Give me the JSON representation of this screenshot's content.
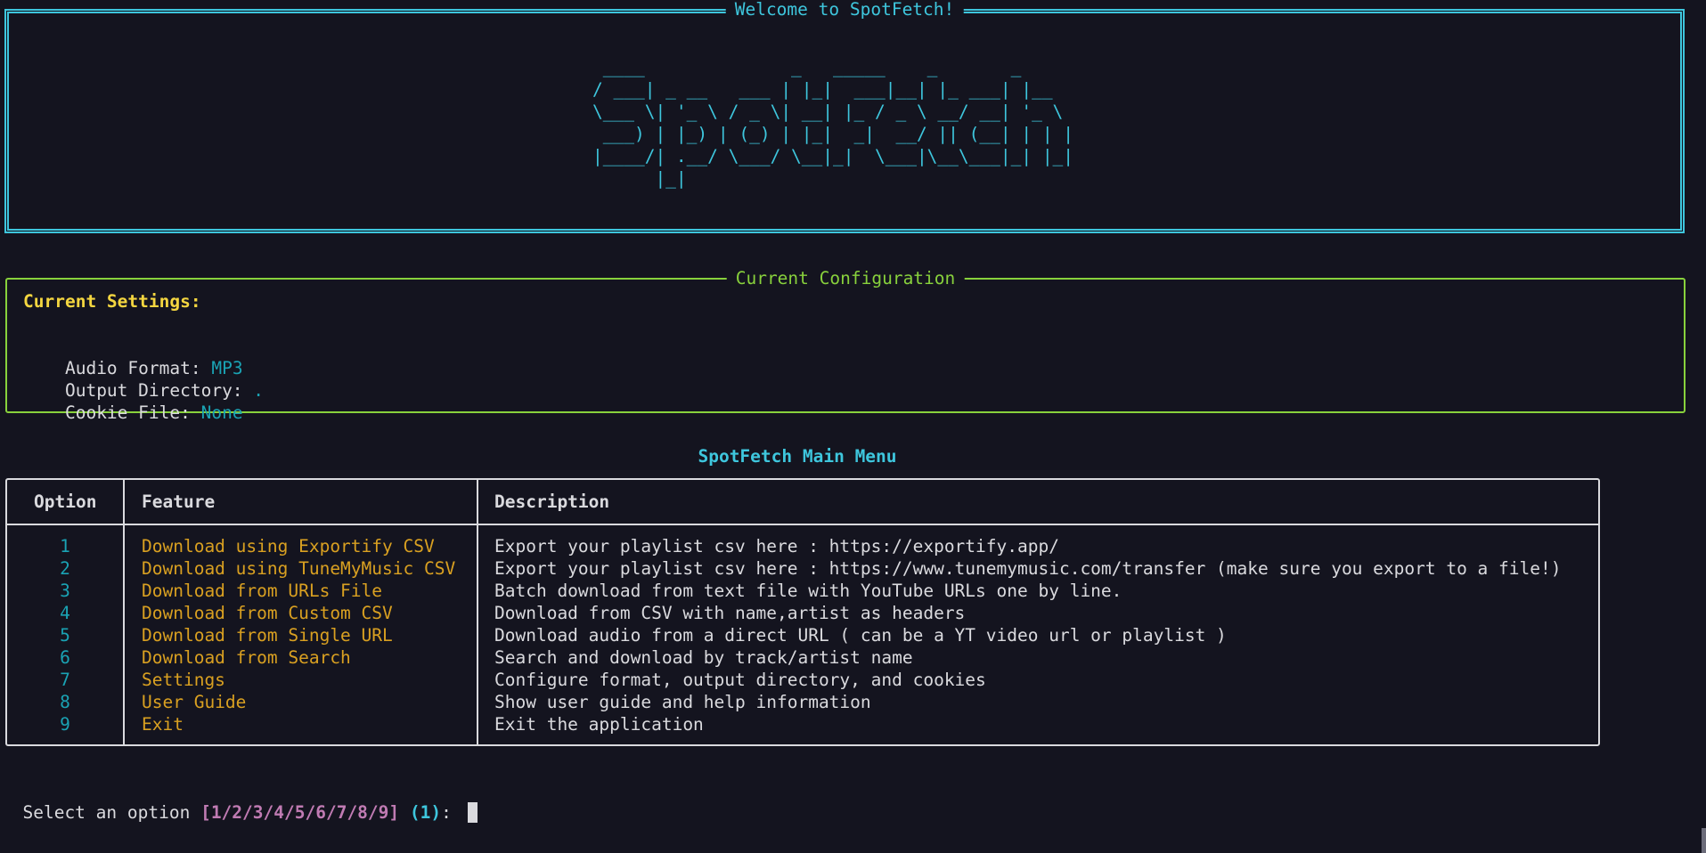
{
  "welcome": {
    "title": "Welcome to SpotFetch!",
    "banner": " ____              _   _____    _       _     \n/ ___| _ __   ___ | |_|  ___|__| |_ ___| |__  \n\\___ \\| '_ \\ / _ \\| __| |_ / _ \\ __/ __| '_ \\ \n ___) | |_) | (_) | |_|  _|  __/ || (__| | | |\n|____/| .__/ \\___/ \\__|_|  \\___|\\__\\___|_| |_|\n      |_|                                     "
  },
  "config": {
    "title": "Current Configuration",
    "heading": "Current Settings:",
    "rows": [
      {
        "label": "Audio Format: ",
        "value": "MP3"
      },
      {
        "label": "Output Directory: ",
        "value": "."
      },
      {
        "label": "Cookie File: ",
        "value": "None"
      }
    ]
  },
  "menu": {
    "title": "SpotFetch Main Menu",
    "headers": [
      "Option",
      "Feature",
      "Description"
    ],
    "rows": [
      {
        "option": "1",
        "feature": "Download using Exportify CSV",
        "description": "Export your playlist csv here : https://exportify.app/"
      },
      {
        "option": "2",
        "feature": "Download using TuneMyMusic CSV",
        "description": "Export your playlist csv here : https://www.tunemymusic.com/transfer (make sure you export to a file!)"
      },
      {
        "option": "3",
        "feature": "Download from URLs File",
        "description": "Batch download from text file with YouTube URLs one by line."
      },
      {
        "option": "4",
        "feature": "Download from Custom CSV",
        "description": "Download from CSV with name,artist as headers"
      },
      {
        "option": "5",
        "feature": "Download from Single URL",
        "description": "Download audio from a direct URL ( can be a YT video url or playlist )"
      },
      {
        "option": "6",
        "feature": "Download from Search",
        "description": "Search and download by track/artist name"
      },
      {
        "option": "7",
        "feature": "Settings",
        "description": "Configure format, output directory, and cookies"
      },
      {
        "option": "8",
        "feature": "User Guide",
        "description": "Show user guide and help information"
      },
      {
        "option": "9",
        "feature": "Exit",
        "description": "Exit the application"
      }
    ]
  },
  "prompt": {
    "text": "Select an option ",
    "choices": "[1/2/3/4/5/6/7/8/9]",
    "default": "(1)",
    "suffix": ": "
  },
  "colors": {
    "accent_cyan": "#3ec6dd",
    "config_green": "#88d13c",
    "heading_yellow": "#f4d640",
    "feature_orange": "#d9a021",
    "choices_magenta": "#c07bb3"
  }
}
